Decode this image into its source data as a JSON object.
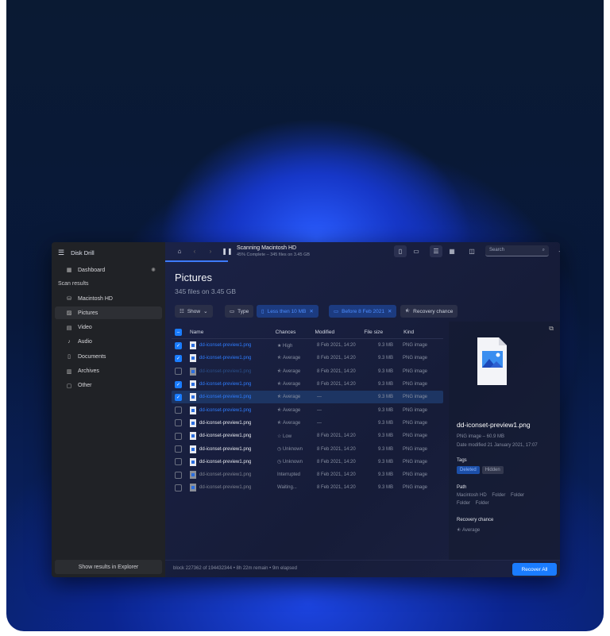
{
  "app": {
    "title": "Disk Drill"
  },
  "sidebar": {
    "dashboard": "Dashboard",
    "section": "Scan results",
    "items": [
      {
        "label": "Macintosh HD",
        "icon": "drive-icon"
      },
      {
        "label": "Pictures",
        "icon": "image-icon"
      },
      {
        "label": "Video",
        "icon": "film-icon"
      },
      {
        "label": "Audio",
        "icon": "music-icon"
      },
      {
        "label": "Documents",
        "icon": "document-icon"
      },
      {
        "label": "Archives",
        "icon": "archive-icon"
      },
      {
        "label": "Other",
        "icon": "other-icon"
      }
    ],
    "active": "Pictures",
    "show_button": "Show results in Explorer"
  },
  "toolbar": {
    "scan_title": "Scanning Macintosh HD",
    "scan_status": "45% Complete – 345 files on 3.45 GB",
    "progress_percent": 45,
    "search_placeholder": "Search"
  },
  "main": {
    "title": "Pictures",
    "subtitle": "345 files on 3.45 GB",
    "filters": {
      "show": "Show",
      "type": "Type",
      "size": "Less then 10 MB",
      "date": "Before 8 Feb 2021",
      "recovery": "Recovery chance"
    },
    "columns": [
      "Name",
      "Chances",
      "Modified",
      "File size",
      "Kind"
    ],
    "rows": [
      {
        "name": "dd-iconset-preview1.png",
        "chance": "★ High",
        "modified": "8 Feb 2021, 14:20",
        "size": "9.3 MB",
        "kind": "PNG image",
        "checked": true,
        "style": "blue"
      },
      {
        "name": "dd-iconset-preview1.png",
        "chance": "⯪ Average",
        "modified": "8 Feb 2021, 14:20",
        "size": "9.3 MB",
        "kind": "PNG image",
        "checked": true,
        "style": "blue"
      },
      {
        "name": "dd-iconset-preview1.png",
        "chance": "⯪ Average",
        "modified": "8 Feb 2021, 14:20",
        "size": "9.3 MB",
        "kind": "PNG image",
        "checked": false,
        "style": "dimblue"
      },
      {
        "name": "dd-iconset-preview1.png",
        "chance": "⯪ Average",
        "modified": "8 Feb 2021, 14:20",
        "size": "9.3 MB",
        "kind": "PNG image",
        "checked": true,
        "style": "blue"
      },
      {
        "name": "dd-iconset-preview1.png",
        "chance": "⯪ Average",
        "modified": "—",
        "size": "9.3 MB",
        "kind": "PNG image",
        "checked": true,
        "style": "blue",
        "selected": true
      },
      {
        "name": "dd-iconset-preview1.png",
        "chance": "⯪ Average",
        "modified": "—",
        "size": "9.3 MB",
        "kind": "PNG image",
        "checked": false,
        "style": "blue"
      },
      {
        "name": "dd-iconset-preview1.png",
        "chance": "⯪ Average",
        "modified": "—",
        "size": "9.3 MB",
        "kind": "PNG image",
        "checked": false,
        "style": "white"
      },
      {
        "name": "dd-iconset-preview1.png",
        "chance": "☆ Low",
        "modified": "8 Feb 2021, 14:20",
        "size": "9.3 MB",
        "kind": "PNG image",
        "checked": false,
        "style": "white"
      },
      {
        "name": "dd-iconset-preview1.png",
        "chance": "◷ Unknown",
        "modified": "8 Feb 2021, 14:20",
        "size": "9.3 MB",
        "kind": "PNG image",
        "checked": false,
        "style": "white"
      },
      {
        "name": "dd-iconset-preview1.png",
        "chance": "◷ Unknown",
        "modified": "8 Feb 2021, 14:20",
        "size": "9.3 MB",
        "kind": "PNG image",
        "checked": false,
        "style": "white"
      },
      {
        "name": "dd-iconset-preview1.png",
        "chance": "Interrupted",
        "modified": "8 Feb 2021, 14:20",
        "size": "9.3 MB",
        "kind": "PNG image",
        "checked": false,
        "style": "dim"
      },
      {
        "name": "dd-iconset-preview1.png",
        "chance": "Waiting...",
        "modified": "8 Feb 2021, 14:20",
        "size": "9.3 MB",
        "kind": "PNG image",
        "checked": false,
        "style": "dim"
      }
    ]
  },
  "detail": {
    "filename": "dd-iconset-preview1.png",
    "info": "PNG image – 60.9 MB",
    "date": "Date modified 21 January 2021, 17:07",
    "tags_label": "Tags",
    "tags": [
      "Deleted",
      "Hidden"
    ],
    "path_label": "Path",
    "path1": "Macintosh HD    Folder    Folder",
    "path2": "Folder    Folder",
    "recovery_label": "Recovery chance",
    "recovery": "⯪ Average"
  },
  "footer": {
    "status": "block 227362 of 194432344 • 8h 22m remain • 9m elapsed",
    "recover_button": "Recover All"
  },
  "colors": {
    "accent": "#1a7cff"
  }
}
